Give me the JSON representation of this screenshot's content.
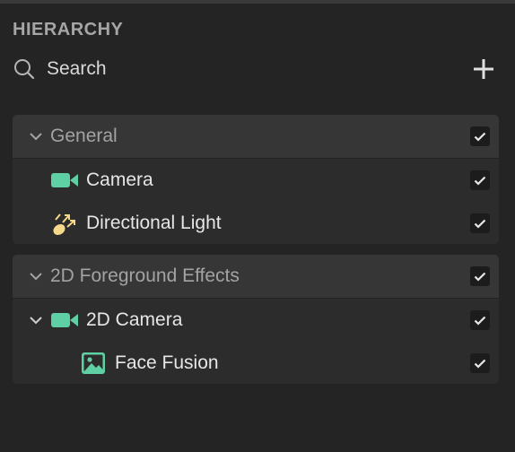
{
  "panel": {
    "title": "HIERARCHY",
    "search_placeholder": "Search"
  },
  "groups": [
    {
      "label": "General",
      "checked": true,
      "items": [
        {
          "label": "Camera",
          "icon": "camera-icon",
          "checked": true
        },
        {
          "label": "Directional Light",
          "icon": "directional-light-icon",
          "checked": true
        }
      ]
    },
    {
      "label": "2D Foreground Effects",
      "checked": true,
      "items": [
        {
          "label": "2D Camera",
          "icon": "camera-icon",
          "checked": true,
          "expanded": true
        },
        {
          "label": "Face Fusion",
          "icon": "image-icon",
          "checked": true
        }
      ]
    }
  ],
  "colors": {
    "background": "#242424",
    "group_background": "#2c2c2c",
    "header_background": "#363636",
    "camera_icon": "#5fcfa4",
    "light_icon": "#f5d88a"
  }
}
